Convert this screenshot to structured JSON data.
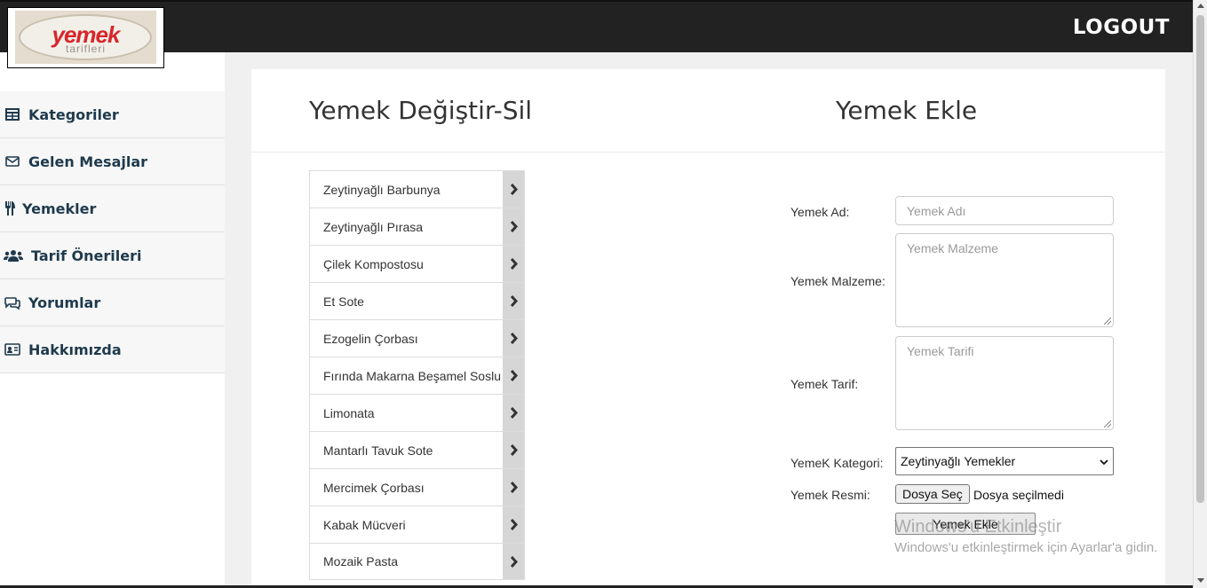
{
  "header": {
    "logo_text": "yemek",
    "logo_subtext": "tarifleri",
    "logout_label": "LOGOUT"
  },
  "sidebar": {
    "items": [
      {
        "label": "Kategoriler",
        "icon": "table-icon"
      },
      {
        "label": "Gelen Mesajlar",
        "icon": "envelope-icon"
      },
      {
        "label": "Yemekler",
        "icon": "utensils-icon"
      },
      {
        "label": "Tarif Önerileri",
        "icon": "users-icon"
      },
      {
        "label": "Yorumlar",
        "icon": "comments-icon"
      },
      {
        "label": "Hakkımızda",
        "icon": "id-card-icon"
      }
    ]
  },
  "main": {
    "left_title": "Yemek Değiştir-Sil",
    "right_title": "Yemek Ekle",
    "food_list": [
      "Zeytinyağlı Barbunya",
      "Zeytinyağlı Pırasa",
      "Çilek Kompostosu",
      "Et Sote",
      "Ezogelin Çorbası",
      "Fırında Makarna Beşamel Soslu",
      "Limonata",
      "Mantarlı Tavuk Sote",
      "Mercimek Çorbası",
      "Kabak Mücveri",
      "Mozaik Pasta"
    ]
  },
  "form": {
    "name_label": "Yemek Ad:",
    "name_placeholder": "Yemek Adı",
    "ingredients_label": "Yemek Malzeme:",
    "ingredients_placeholder": "Yemek Malzeme",
    "recipe_label": "Yemek Tarif:",
    "recipe_placeholder": "Yemek Tarifi",
    "category_label": "YemeK Kategori:",
    "category_selected": "Zeytinyağlı Yemekler",
    "image_label": "Yemek Resmi:",
    "file_button": "Dosya Seç",
    "file_status": "Dosya seçilmedi",
    "submit_label": "Yemek Ekle"
  },
  "watermark": {
    "title": "Windows'u Etkinleştir",
    "subtitle": "Windows'u etkinleştirmek için Ayarlar'a gidin."
  }
}
